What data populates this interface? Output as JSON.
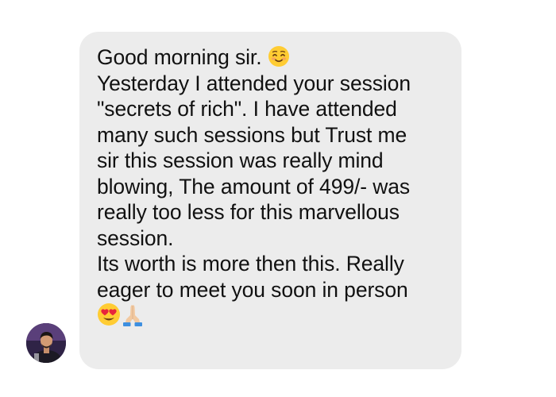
{
  "message": {
    "lines": [
      "Good morning sir.",
      "Yesterday I attended your session",
      "\"secrets of rich\". I have attended",
      "many such sessions but Trust me",
      "sir this session was really mind",
      "blowing, The amount of 499/- was",
      "really too less for this marvellous",
      "session.",
      "Its worth is more then this.  Really",
      "eager to meet you soon in person"
    ],
    "emojis": {
      "after_greeting": "smiling-face-with-smiling-eyes-emoji",
      "final": [
        "heart-eyes-emoji",
        "folded-hands-emoji"
      ]
    }
  },
  "colors": {
    "bubble_background": "#ececec",
    "text": "#111111",
    "page_background": "#ffffff"
  }
}
